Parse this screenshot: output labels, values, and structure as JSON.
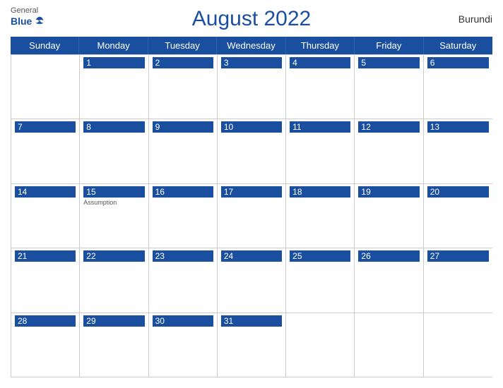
{
  "header": {
    "logo_general": "General",
    "logo_blue": "Blue",
    "title": "August 2022",
    "country": "Burundi"
  },
  "days_of_week": [
    "Sunday",
    "Monday",
    "Tuesday",
    "Wednesday",
    "Thursday",
    "Friday",
    "Saturday"
  ],
  "weeks": [
    [
      {
        "day": "",
        "holiday": ""
      },
      {
        "day": "1",
        "holiday": ""
      },
      {
        "day": "2",
        "holiday": ""
      },
      {
        "day": "3",
        "holiday": ""
      },
      {
        "day": "4",
        "holiday": ""
      },
      {
        "day": "5",
        "holiday": ""
      },
      {
        "day": "6",
        "holiday": ""
      }
    ],
    [
      {
        "day": "7",
        "holiday": ""
      },
      {
        "day": "8",
        "holiday": ""
      },
      {
        "day": "9",
        "holiday": ""
      },
      {
        "day": "10",
        "holiday": ""
      },
      {
        "day": "11",
        "holiday": ""
      },
      {
        "day": "12",
        "holiday": ""
      },
      {
        "day": "13",
        "holiday": ""
      }
    ],
    [
      {
        "day": "14",
        "holiday": ""
      },
      {
        "day": "15",
        "holiday": "Assumption"
      },
      {
        "day": "16",
        "holiday": ""
      },
      {
        "day": "17",
        "holiday": ""
      },
      {
        "day": "18",
        "holiday": ""
      },
      {
        "day": "19",
        "holiday": ""
      },
      {
        "day": "20",
        "holiday": ""
      }
    ],
    [
      {
        "day": "21",
        "holiday": ""
      },
      {
        "day": "22",
        "holiday": ""
      },
      {
        "day": "23",
        "holiday": ""
      },
      {
        "day": "24",
        "holiday": ""
      },
      {
        "day": "25",
        "holiday": ""
      },
      {
        "day": "26",
        "holiday": ""
      },
      {
        "day": "27",
        "holiday": ""
      }
    ],
    [
      {
        "day": "28",
        "holiday": ""
      },
      {
        "day": "29",
        "holiday": ""
      },
      {
        "day": "30",
        "holiday": ""
      },
      {
        "day": "31",
        "holiday": ""
      },
      {
        "day": "",
        "holiday": ""
      },
      {
        "day": "",
        "holiday": ""
      },
      {
        "day": "",
        "holiday": ""
      }
    ]
  ],
  "colors": {
    "blue": "#1a4fa0",
    "header_text": "#ffffff",
    "border": "#cccccc"
  }
}
